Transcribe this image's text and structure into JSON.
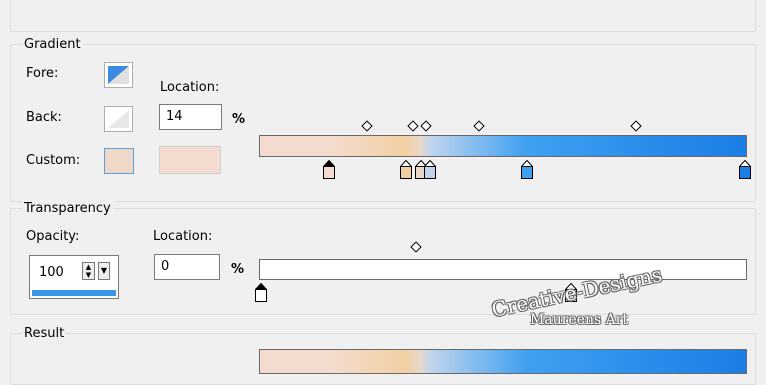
{
  "gradient": {
    "title": "Gradient",
    "fore_label": "Fore:",
    "back_label": "Back:",
    "custom_label": "Custom:",
    "location_label": "Location:",
    "location_value": "14",
    "percent": "%",
    "colors": {
      "fore_dark": "#3a8be0",
      "back_light": "#f5f5f5",
      "custom": "#f0d8c8",
      "peach": "#f3dccf",
      "tan": "#f1cfa2",
      "blue": "#3ea0f0",
      "deep_blue": "#1a7ee6"
    },
    "stops": [
      {
        "location": 14,
        "color": "#f3dccf",
        "selected": true
      },
      {
        "location": 30,
        "color": "#f1cfa2"
      },
      {
        "location": 33,
        "color": "#e8d6c8"
      },
      {
        "location": 35,
        "color": "#c0d4ec"
      },
      {
        "location": 55,
        "color": "#3ea0f0"
      },
      {
        "location": 100,
        "color": "#1a7ee6"
      }
    ],
    "midpoints": [
      22,
      31.5,
      34,
      45,
      77.5
    ]
  },
  "transparency": {
    "title": "Transparency",
    "opacity_label": "Opacity:",
    "opacity_value": "100",
    "location_label": "Location:",
    "location_value": "0",
    "percent": "%",
    "stops": [
      {
        "location": 0,
        "selected": true
      },
      {
        "location": 64
      }
    ],
    "midpoint": 32
  },
  "result": {
    "title": "Result"
  },
  "watermark": {
    "line1": "Creative-Designs",
    "line2": "Maureens Art"
  }
}
